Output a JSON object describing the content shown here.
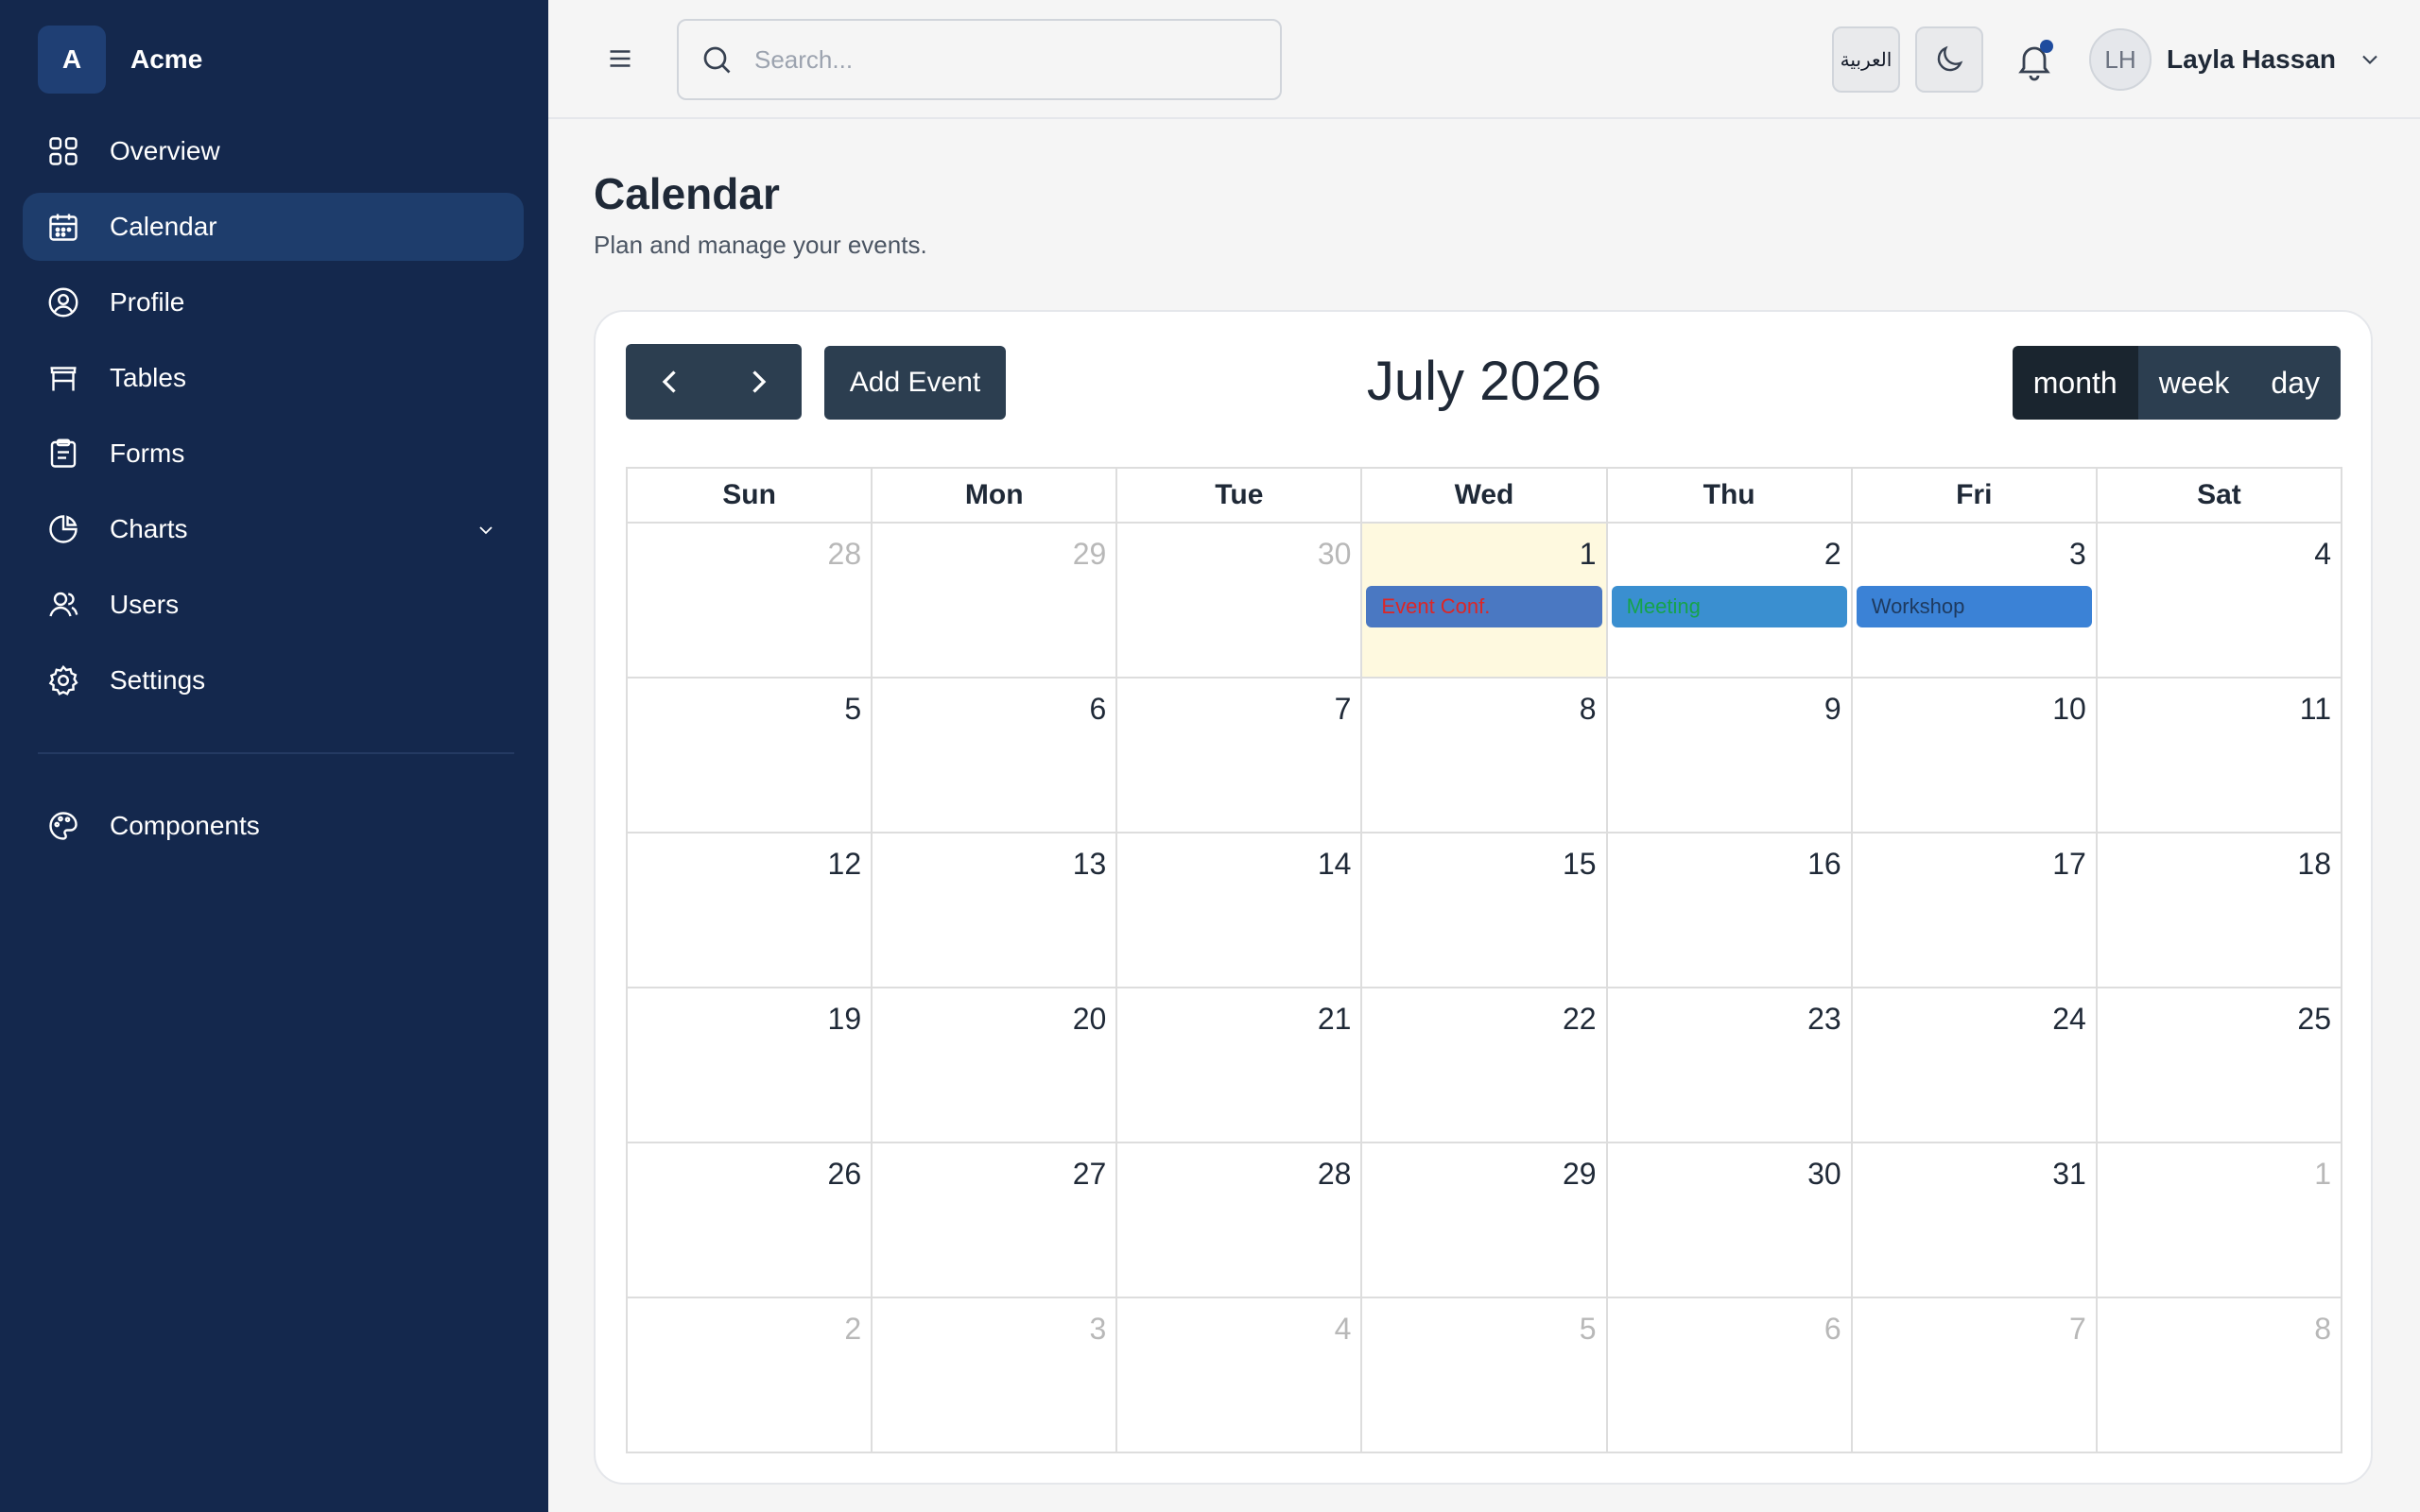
{
  "brand": {
    "initial": "A",
    "name": "Acme"
  },
  "sidebar": {
    "items": [
      {
        "label": "Overview",
        "icon": "grid-icon"
      },
      {
        "label": "Calendar",
        "icon": "calendar-icon",
        "active": true
      },
      {
        "label": "Profile",
        "icon": "user-circle-icon"
      },
      {
        "label": "Tables",
        "icon": "table-icon"
      },
      {
        "label": "Forms",
        "icon": "clipboard-icon"
      },
      {
        "label": "Charts",
        "icon": "pie-chart-icon",
        "has_submenu": true
      },
      {
        "label": "Users",
        "icon": "users-icon"
      },
      {
        "label": "Settings",
        "icon": "gear-icon"
      }
    ],
    "secondary": [
      {
        "label": "Components",
        "icon": "palette-icon"
      }
    ]
  },
  "header": {
    "search_placeholder": "Search...",
    "language_label": "العربية",
    "user": {
      "initials": "LH",
      "name": "Layla Hassan"
    }
  },
  "page": {
    "title": "Calendar",
    "subtitle": "Plan and manage your events."
  },
  "calendar": {
    "add_event_label": "Add Event",
    "month_title": "July 2026",
    "views": [
      "month",
      "week",
      "day"
    ],
    "active_view": "month",
    "weekdays": [
      "Sun",
      "Mon",
      "Tue",
      "Wed",
      "Thu",
      "Fri",
      "Sat"
    ],
    "weeks": [
      [
        {
          "d": "28",
          "o": true
        },
        {
          "d": "29",
          "o": true
        },
        {
          "d": "30",
          "o": true
        },
        {
          "d": "1",
          "today": true
        },
        {
          "d": "2"
        },
        {
          "d": "3"
        },
        {
          "d": "4"
        }
      ],
      [
        {
          "d": "5"
        },
        {
          "d": "6"
        },
        {
          "d": "7"
        },
        {
          "d": "8"
        },
        {
          "d": "9"
        },
        {
          "d": "10"
        },
        {
          "d": "11"
        }
      ],
      [
        {
          "d": "12"
        },
        {
          "d": "13"
        },
        {
          "d": "14"
        },
        {
          "d": "15"
        },
        {
          "d": "16"
        },
        {
          "d": "17"
        },
        {
          "d": "18"
        }
      ],
      [
        {
          "d": "19"
        },
        {
          "d": "20"
        },
        {
          "d": "21"
        },
        {
          "d": "22"
        },
        {
          "d": "23"
        },
        {
          "d": "24"
        },
        {
          "d": "25"
        }
      ],
      [
        {
          "d": "26"
        },
        {
          "d": "27"
        },
        {
          "d": "28"
        },
        {
          "d": "29"
        },
        {
          "d": "30"
        },
        {
          "d": "31"
        },
        {
          "d": "1",
          "o": true
        }
      ],
      [
        {
          "d": "2",
          "o": true
        },
        {
          "d": "3",
          "o": true
        },
        {
          "d": "4",
          "o": true
        },
        {
          "d": "5",
          "o": true
        },
        {
          "d": "6",
          "o": true
        },
        {
          "d": "7",
          "o": true
        },
        {
          "d": "8",
          "o": true
        }
      ]
    ],
    "events": [
      {
        "title": "Event Conf.",
        "week": 0,
        "day": 3,
        "bg": "#4a78c2",
        "text_color": "#dc2626"
      },
      {
        "title": "Meeting",
        "week": 0,
        "day": 4,
        "bg": "#3a8fd0",
        "text_color": "#16a34a"
      },
      {
        "title": "Workshop",
        "week": 0,
        "day": 5,
        "bg": "#3b82d6",
        "text_color": "#1e3a5f"
      }
    ]
  },
  "colors": {
    "sidebar_bg": "#14284d",
    "sidebar_active": "#1e3d6c",
    "button_dark": "#2c3e50",
    "today_bg": "#fef9df"
  }
}
